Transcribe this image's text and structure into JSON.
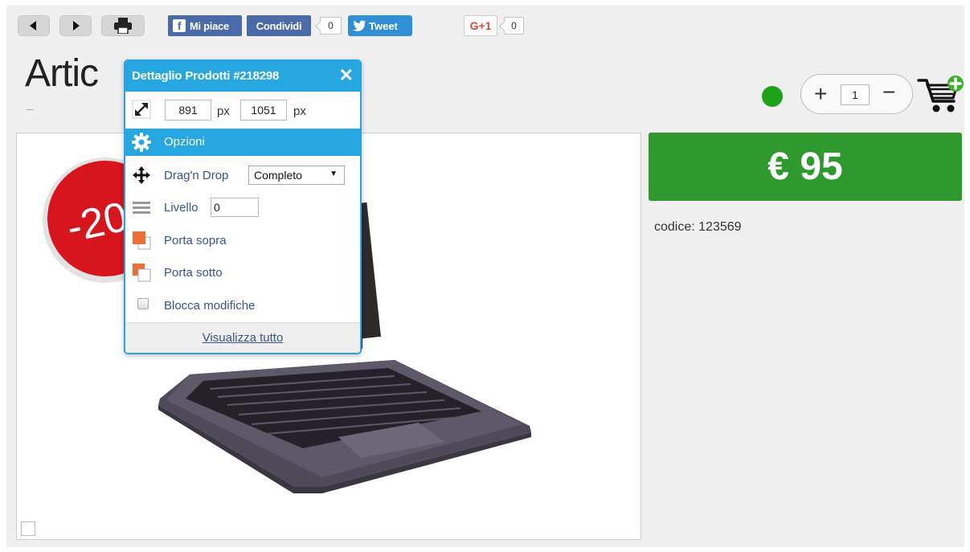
{
  "toolbar": {
    "facebook_like": "Mi piace",
    "facebook_share": "Condividi",
    "share_count": "0",
    "tweet": "Tweet",
    "gplus": "G+1",
    "gplus_count": "0"
  },
  "page": {
    "title": "Artic"
  },
  "discount": {
    "label": "-20"
  },
  "popup": {
    "title": "Dettaglio Prodotti #218298",
    "close_icon": "close-icon",
    "width_value": "891",
    "height_value": "1051",
    "unit": "px",
    "options_label": "Opzioni",
    "drag_label": "Drag'n Drop",
    "drag_mode": "Completo",
    "level_label": "Livello",
    "level_value": "0",
    "bring_front": "Porta sopra",
    "send_back": "Porta sotto",
    "lock_edits": "Blocca modifiche",
    "view_all": "Visualizza tutto"
  },
  "cart": {
    "quantity": "1",
    "price": "€ 95",
    "code_label": "codice: 123569"
  },
  "colors": {
    "accent": "#27a7e1",
    "price_green": "#2e9a2e",
    "status_green": "#1fa318",
    "facebook": "#4b6aa8",
    "twitter": "#2f8fd6",
    "discount_red": "#d8141c"
  }
}
